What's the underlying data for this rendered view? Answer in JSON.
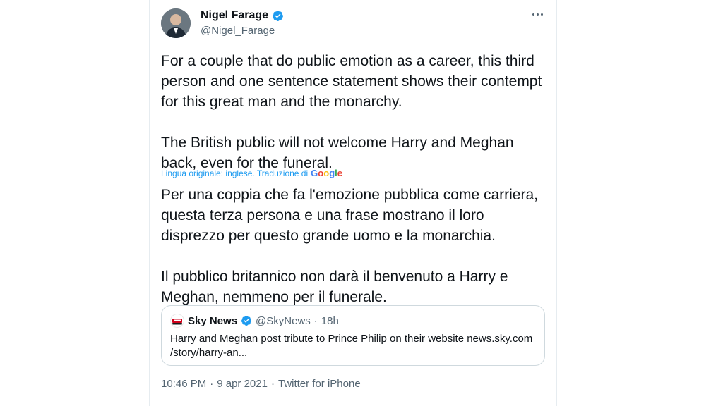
{
  "author": {
    "name": "Nigel Farage",
    "handle": "@Nigel_Farage",
    "verified": true
  },
  "tweet": {
    "text": "For a couple that do public emotion as a career, this third person and one sentence statement shows their contempt for this great man and the monarchy.\n\nThe British public will not welcome Harry and Meghan back, even for the funeral.",
    "translation_label": "Lingua originale: inglese. Traduzione di",
    "translation_provider": "Google",
    "translated_text": "Per una coppia che fa l'emozione pubblica come carriera, questa terza persona e una frase mostrano il loro disprezzo per questo grande uomo e la monarchia.\n\n Il pubblico britannico non darà il benvenuto a Harry e Meghan, nemmeno per il funerale."
  },
  "quoted_tweet": {
    "name": "Sky News",
    "handle": "@SkyNews",
    "separator": "·",
    "time": "18h",
    "verified": true,
    "text": "Harry and Meghan post tribute to Prince Philip on their website news.sky.com /story/harry-an..."
  },
  "meta": {
    "time": "10:46 PM",
    "separator": "·",
    "date": "9 apr 2021",
    "separator2": "·",
    "source": "Twitter for iPhone"
  },
  "colors": {
    "link": "#1d9bf0",
    "verified": "#1d9bf0",
    "secondary_text": "#536471",
    "sky_red": "#d0021b"
  },
  "icons": {
    "verified": "verified-badge-icon",
    "more": "more-horizontal-icon"
  }
}
